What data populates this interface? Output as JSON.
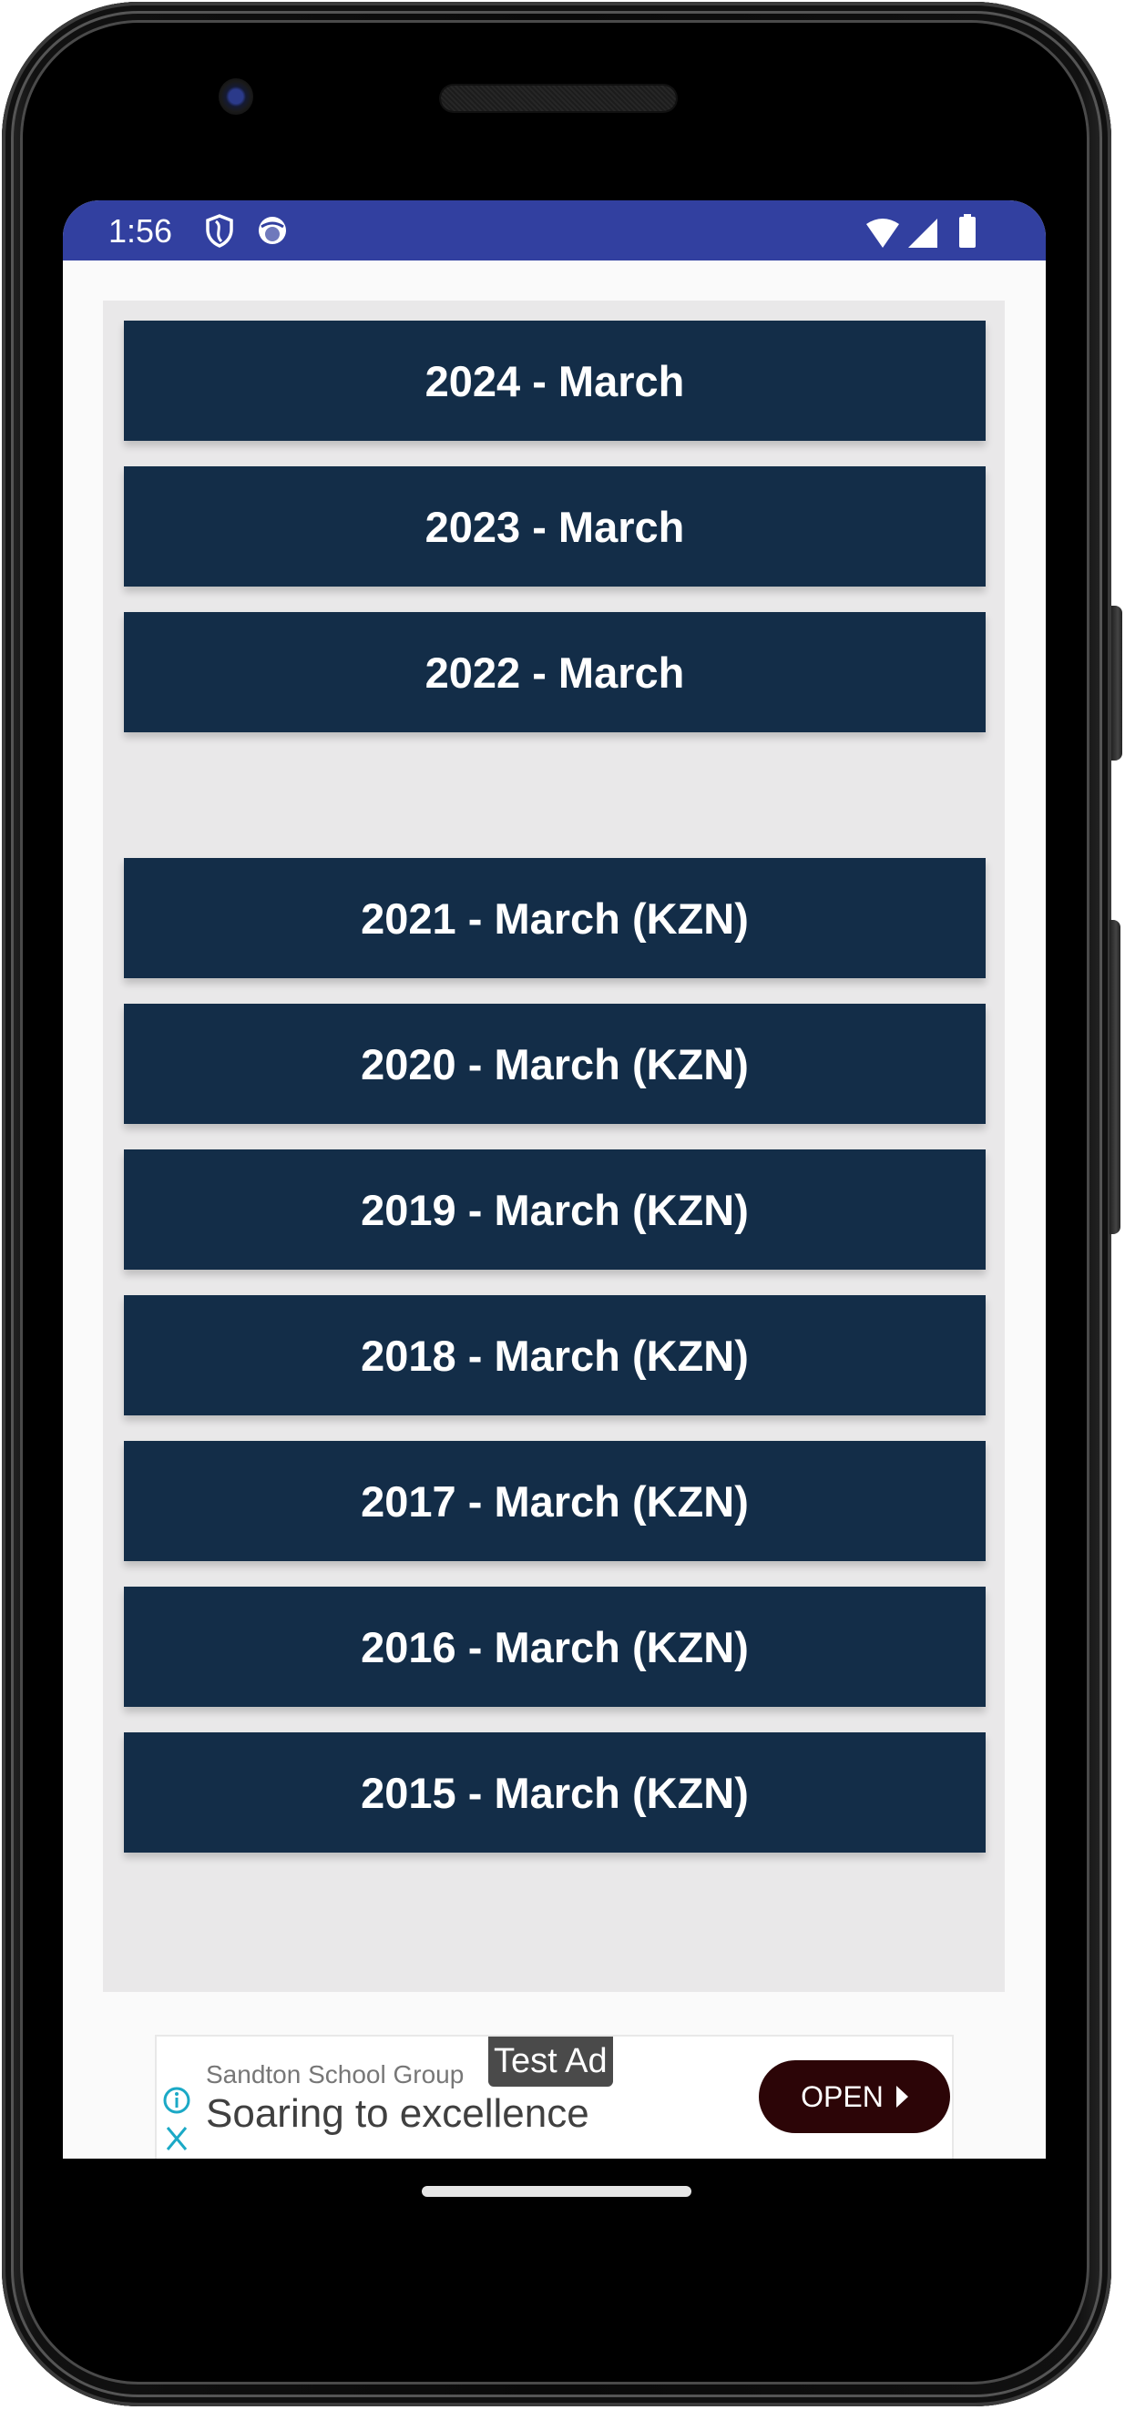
{
  "status_bar": {
    "time": "1:56",
    "left_icons": [
      "shield-icon",
      "face-icon"
    ],
    "right_icons": [
      "wifi-icon",
      "cellular-signal-icon",
      "battery-icon"
    ],
    "background_color": "#3240A0"
  },
  "exam_list": {
    "button_color": "#132D48",
    "panel_color": "#E9E8E9",
    "groups": [
      {
        "items": [
          {
            "label": "2024 - March"
          },
          {
            "label": "2023 - March"
          },
          {
            "label": "2022 - March"
          }
        ]
      },
      {
        "items": [
          {
            "label": "2021 - March (KZN)"
          },
          {
            "label": "2020 - March (KZN)"
          },
          {
            "label": "2019 - March (KZN)"
          },
          {
            "label": "2018 - March (KZN)"
          },
          {
            "label": "2017 - March (KZN)"
          },
          {
            "label": "2016 - March (KZN)"
          },
          {
            "label": "2015 - March (KZN)"
          }
        ]
      }
    ]
  },
  "ad": {
    "advertiser": "Sandton School Group",
    "badge": "Test Ad",
    "headline": "Soaring to excellence",
    "cta_label": "OPEN",
    "cta_color": "#2C0507",
    "accent_color": "#1BA9C6"
  }
}
